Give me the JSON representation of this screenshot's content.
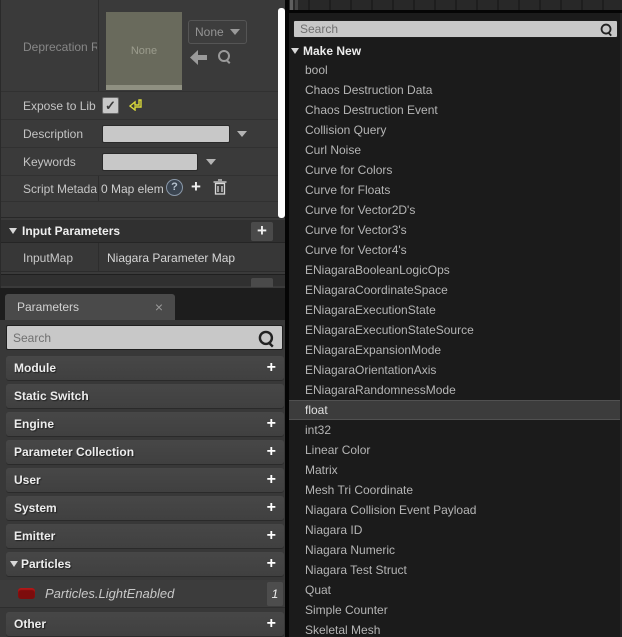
{
  "icons": {
    "plus": "+",
    "close": "×",
    "check": "✓",
    "question": "?"
  },
  "details": {
    "deprecation": {
      "label": "Deprecation R",
      "thumb_text": "None",
      "combo_value": "None"
    },
    "expose": {
      "label": "Expose to Lib"
    },
    "description": {
      "label": "Description"
    },
    "keywords": {
      "label": "Keywords"
    },
    "script_metadata": {
      "label": "Script Metada",
      "value": "0 Map elem"
    },
    "input_parameters": {
      "title": "Input Parameters",
      "rows": [
        {
          "name": "InputMap",
          "value": "Niagara Parameter Map"
        }
      ]
    }
  },
  "parameters_panel": {
    "tab_label": "Parameters",
    "search_placeholder": "Search",
    "categories": [
      {
        "label": "Module",
        "add": true
      },
      {
        "label": "Static Switch",
        "add": false
      },
      {
        "label": "Engine",
        "add": true
      },
      {
        "label": "Parameter Collection",
        "add": true
      },
      {
        "label": "User",
        "add": true
      },
      {
        "label": "System",
        "add": true
      },
      {
        "label": "Emitter",
        "add": true
      },
      {
        "label": "Particles",
        "add": true,
        "expanded": true,
        "children": [
          {
            "label": "Particles.LightEnabled",
            "count": "1",
            "type_color": "#7d0c0c"
          }
        ]
      },
      {
        "label": "Other",
        "add": true
      }
    ]
  },
  "type_picker": {
    "search_placeholder": "Search",
    "group_label": "Make New",
    "highlighted": "float",
    "items": [
      "bool",
      "Chaos Destruction Data",
      "Chaos Destruction Event",
      "Collision Query",
      "Curl Noise",
      "Curve for Colors",
      "Curve for Floats",
      "Curve for Vector2D's",
      "Curve for Vector3's",
      "Curve for Vector4's",
      "ENiagaraBooleanLogicOps",
      "ENiagaraCoordinateSpace",
      "ENiagaraExecutionState",
      "ENiagaraExecutionStateSource",
      "ENiagaraExpansionMode",
      "ENiagaraOrientationAxis",
      "ENiagaraRandomnessMode",
      "float",
      "int32",
      "Linear Color",
      "Matrix",
      "Mesh Tri Coordinate",
      "Niagara Collision Event Payload",
      "Niagara ID",
      "Niagara Numeric",
      "Niagara Test Struct",
      "Quat",
      "Simple Counter",
      "Skeletal Mesh"
    ]
  },
  "colors": {
    "accent_red": "#7d0c0c",
    "highlight_row": "#3c3c3c",
    "panel_dark": "#1b1b1b",
    "panel_mid": "#3a3a3a",
    "reset_yellow": "#d8d83a"
  }
}
